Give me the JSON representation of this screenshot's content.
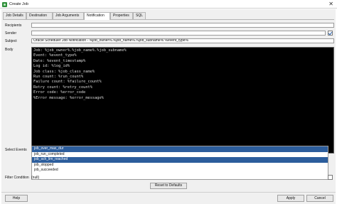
{
  "window": {
    "title": "Create Job",
    "close_glyph": "✕"
  },
  "tabs": [
    {
      "label": "Job Details",
      "active": false
    },
    {
      "label": "Destination",
      "active": false
    },
    {
      "label": "Job Arguments",
      "active": false
    },
    {
      "label": "Notification",
      "active": true
    },
    {
      "label": "Properties",
      "active": false
    },
    {
      "label": "SQL",
      "active": false
    }
  ],
  "form": {
    "recipients_label": "Recipients",
    "recipients_value": "",
    "sender_label": "Sender",
    "sender_value": "",
    "subject_label": "Subject",
    "subject_value": "Oracle Scheduler Job Notification - %job_owner%.%job_name%.%job_subname% %event_type%",
    "body_label": "Body",
    "body_lines": [
      "Job: %job_owner%.%job_name%.%job_subname%",
      "Event: %event_type%",
      "Date: %event_timestamp%",
      "Log id: %log_id%",
      "Job class: %job_class_name%",
      "Run count: %run_count%",
      "Failure count: %failure_count%",
      "Retry count: %retry_count%",
      "Error code: %error_code",
      "%Error message: %error_message%"
    ],
    "select_events_label": "Select Events",
    "events": [
      {
        "label": "job_over_max_dur",
        "selected": true
      },
      {
        "label": "job_run_completed",
        "selected": false
      },
      {
        "label": "job_sch_lim_reached",
        "selected": true
      },
      {
        "label": "job_stopped",
        "selected": false
      },
      {
        "label": "job_succeeded",
        "selected": false
      }
    ],
    "filter_label": "Filter Condition",
    "filter_value": "(null)"
  },
  "buttons": {
    "reset": "Reset to Defaults",
    "help": "Help",
    "apply": "Apply",
    "cancel": "Cancel"
  },
  "colors": {
    "selection": "#2c5d9c",
    "body_background": "#000000",
    "dialog_background": "#f0f0f0"
  }
}
